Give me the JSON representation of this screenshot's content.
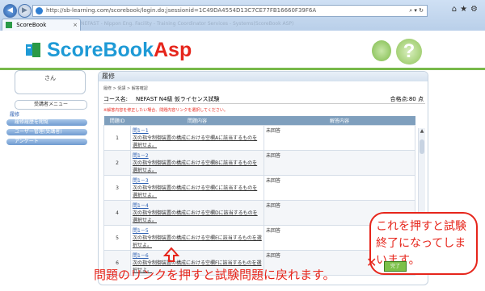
{
  "browser": {
    "url": "http://sb-learning.com/scorebook/login.do;jsessionid=1C49DA4554D13C7CE77FB16660F39F6A",
    "tab_title": "ScoreBook",
    "favorites_hint": "NEFAST - Nippon Eng. Facility - Training Coordinator Services - Systems(ScoreBook ASP)"
  },
  "header": {
    "logo_main": "ScoreBook",
    "logo_asp": "Asp",
    "help": "?"
  },
  "sidebar": {
    "user_name": "さん",
    "menu_title": "受講者メニュー",
    "link_home": "履修",
    "items": [
      "履修履歴を閲覧",
      "ユーザー管理(受講者)",
      "アンケート"
    ]
  },
  "main": {
    "title": "履修",
    "breadcrumb": "履修 > 受講 > 解答確認",
    "course_label": "コース名:",
    "course_name": "NEFAST N4級 仮ライセンス試験",
    "pass_score": "合格点:80 点",
    "warning": "※解答内容を修正したい場合、問題内容リンクを選択してください。",
    "columns": [
      "問題ID",
      "問題内容",
      "解答内容"
    ],
    "rows": [
      {
        "no": "1",
        "id": "問1－1",
        "text": "次の指令制御装置の構成における空欄Aに該当するものを選択せよ。",
        "answer": "未回答"
      },
      {
        "no": "2",
        "id": "問1－2",
        "text": "次の指令制御装置の構成における空欄Bに該当するものを選択せよ。",
        "answer": "未回答"
      },
      {
        "no": "3",
        "id": "問1－3",
        "text": "次の指令制御装置の構成における空欄Cに該当するものを選択せよ。",
        "answer": "未回答"
      },
      {
        "no": "4",
        "id": "問1－4",
        "text": "次の指令制御装置の構成における空欄Dに該当するものを選択せよ。",
        "answer": "未回答"
      },
      {
        "no": "5",
        "id": "問1－5",
        "text": "次の指令制御装置の構成における空欄Eに該当するものを選択せよ。",
        "answer": "未回答"
      },
      {
        "no": "6",
        "id": "問1－6",
        "text": "次の指令制御装置の構成における空欄Fに該当するものを選択せよ。",
        "answer": "未回答"
      }
    ]
  },
  "annotations": {
    "callout_text": "これを押すと試験終了になってしまいます。",
    "finish_button": "完了",
    "caption": "問題のリンクを押すと試験問題に戻れます。"
  },
  "colors": {
    "accent_red": "#e6251b",
    "brand_blue": "#1e9ad6",
    "green": "#78b94a"
  }
}
